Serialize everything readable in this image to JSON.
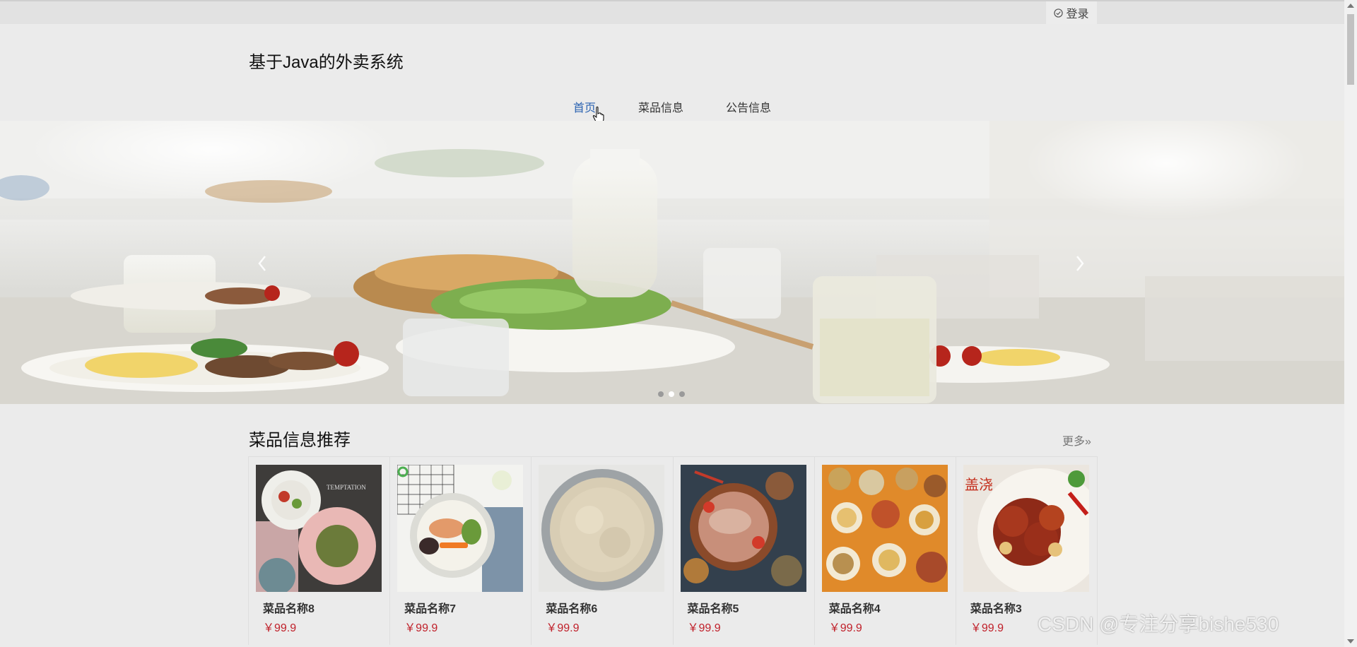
{
  "topbar": {
    "login_label": "登录",
    "login_icon": "check-circle-icon"
  },
  "header": {
    "title": "基于Java的外卖系统"
  },
  "nav": {
    "items": [
      {
        "label": "首页",
        "active": true
      },
      {
        "label": "菜品信息"
      },
      {
        "label": "公告信息"
      }
    ]
  },
  "banner": {
    "slide_count": 3,
    "active_slide": 2,
    "prev_icon": "chevron-left-icon",
    "next_icon": "chevron-right-icon"
  },
  "section": {
    "title": "菜品信息推荐",
    "more_label": "更多",
    "more_icon": "double-chevron-right-icon"
  },
  "dishes": [
    {
      "name": "菜品名称8",
      "price": "￥99.9"
    },
    {
      "name": "菜品名称7",
      "price": "￥99.9"
    },
    {
      "name": "菜品名称6",
      "price": "￥99.9"
    },
    {
      "name": "菜品名称5",
      "price": "￥99.9"
    },
    {
      "name": "菜品名称4",
      "price": "￥99.9"
    },
    {
      "name": "菜品名称3",
      "price": "￥99.9"
    }
  ],
  "watermark": "CSDN @专注分享bishe530",
  "colors": {
    "accent": "#2b63b1",
    "price": "#c0202a",
    "background": "#ebebeb"
  }
}
